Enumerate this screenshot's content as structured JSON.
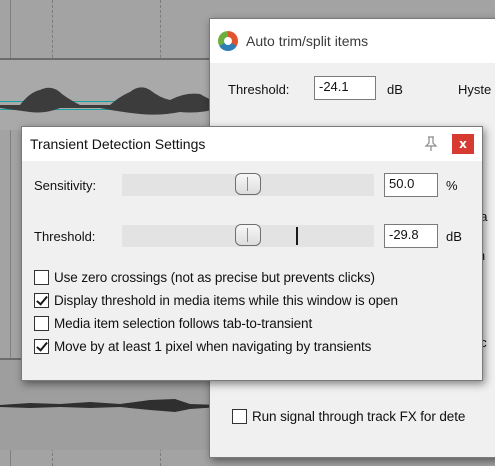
{
  "trim_window": {
    "title": "Auto trim/split items",
    "threshold_label": "Threshold:",
    "threshold_value": "-24.1",
    "threshold_unit": "dB",
    "hysteresis_label_partial": "Hyste",
    "frag_pa": "pa",
    "frag_in": "in",
    "frag_ec": "ec",
    "run_fx_label_partial": "Run signal through track FX for dete"
  },
  "transient_window": {
    "title": "Transient Detection Settings",
    "pin_icon": "pin-icon",
    "close_label": "x",
    "sensitivity": {
      "label": "Sensitivity:",
      "value": "50.0",
      "unit": "%",
      "level": 0.5
    },
    "threshold": {
      "label": "Threshold:",
      "value": "-29.8",
      "unit": "dB"
    },
    "options": [
      {
        "label": "Use zero crossings (not as precise but prevents clicks)",
        "checked": false
      },
      {
        "label": "Display threshold in media items while this window is open",
        "checked": true
      },
      {
        "label": "Media item selection follows tab-to-transient",
        "checked": false
      },
      {
        "label": "Move by at least 1 pixel when navigating by transients",
        "checked": true
      }
    ]
  },
  "colors": {
    "close_button": "#d63a30",
    "threshold_line": "#1aa0a0",
    "dialog_bg": "#f0f0f0"
  }
}
